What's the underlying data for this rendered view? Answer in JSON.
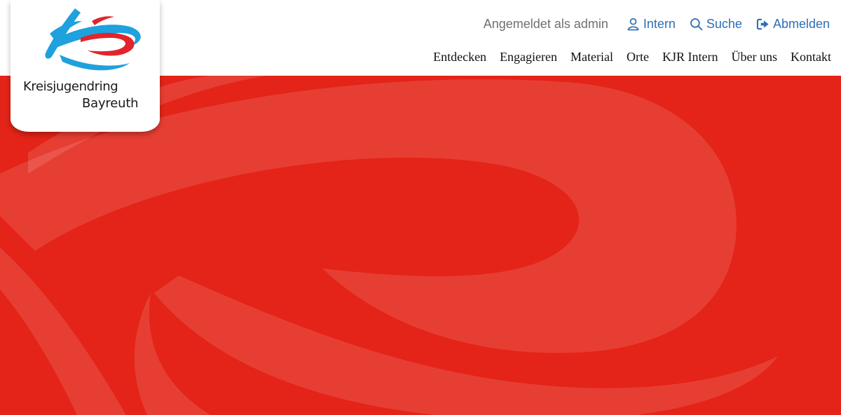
{
  "logo": {
    "line1": "Kreisjugendring",
    "line2": "Bayreuth",
    "icon": "kjr-logo-mark",
    "colors": {
      "blue": "#1ea1dd",
      "red": "#e3242b"
    }
  },
  "user_bar": {
    "status": "Angemeldet als admin",
    "links": [
      {
        "label": "Intern",
        "icon": "user-icon"
      },
      {
        "label": "Suche",
        "icon": "search-icon"
      },
      {
        "label": "Abmelden",
        "icon": "sign-out-icon"
      }
    ]
  },
  "main_nav": {
    "items": [
      "Entdecken",
      "Engagieren",
      "Material",
      "Orte",
      "KJR Intern",
      "Über uns",
      "Kontakt"
    ]
  },
  "hero": {
    "background": "#e42418",
    "pattern": "logo-swirl-watermark"
  },
  "colors": {
    "link": "#2d6fb6",
    "muted_text": "#707070",
    "nav_text": "#111111"
  }
}
